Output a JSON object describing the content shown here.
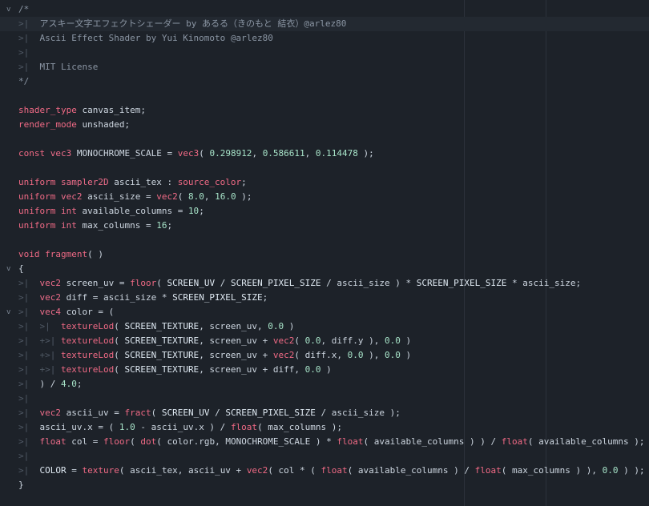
{
  "editor": {
    "lines": [
      {
        "fold": "v",
        "tokens": [
          {
            "t": "c",
            "v": "/*"
          }
        ]
      },
      {
        "fold": "",
        "tokens": [
          {
            "t": "tab",
            "v": ">|  "
          },
          {
            "t": "c",
            "v": "アスキー文字エフェクトシェーダー by あるる（きのもと 結衣）@arlez80"
          }
        ]
      },
      {
        "fold": "",
        "tokens": [
          {
            "t": "tab",
            "v": ">|  "
          },
          {
            "t": "c",
            "v": "Ascii Effect Shader by Yui Kinomoto @arlez80"
          }
        ]
      },
      {
        "fold": "",
        "tokens": [
          {
            "t": "tab",
            "v": ">|"
          }
        ]
      },
      {
        "fold": "",
        "tokens": [
          {
            "t": "tab",
            "v": ">|  "
          },
          {
            "t": "c",
            "v": "MIT License"
          }
        ]
      },
      {
        "fold": "",
        "tokens": [
          {
            "t": "c",
            "v": "*/"
          }
        ]
      },
      {
        "fold": "",
        "tokens": []
      },
      {
        "fold": "",
        "tokens": [
          {
            "t": "k",
            "v": "shader_type"
          },
          {
            "t": "p",
            "v": " canvas_item;"
          }
        ]
      },
      {
        "fold": "",
        "tokens": [
          {
            "t": "k",
            "v": "render_mode"
          },
          {
            "t": "p",
            "v": " unshaded;"
          }
        ]
      },
      {
        "fold": "",
        "tokens": []
      },
      {
        "fold": "",
        "tokens": [
          {
            "t": "k",
            "v": "const"
          },
          {
            "t": "p",
            "v": " "
          },
          {
            "t": "t",
            "v": "vec3"
          },
          {
            "t": "p",
            "v": " MONOCHROME_SCALE = "
          },
          {
            "t": "f",
            "v": "vec3"
          },
          {
            "t": "p",
            "v": "( "
          },
          {
            "t": "n",
            "v": "0.298912"
          },
          {
            "t": "p",
            "v": ", "
          },
          {
            "t": "n",
            "v": "0.586611"
          },
          {
            "t": "p",
            "v": ", "
          },
          {
            "t": "n",
            "v": "0.114478"
          },
          {
            "t": "p",
            "v": " );"
          }
        ]
      },
      {
        "fold": "",
        "tokens": []
      },
      {
        "fold": "",
        "tokens": [
          {
            "t": "k",
            "v": "uniform"
          },
          {
            "t": "p",
            "v": " "
          },
          {
            "t": "t",
            "v": "sampler2D"
          },
          {
            "t": "p",
            "v": " ascii_tex : "
          },
          {
            "t": "k",
            "v": "source_color"
          },
          {
            "t": "p",
            "v": ";"
          }
        ]
      },
      {
        "fold": "",
        "tokens": [
          {
            "t": "k",
            "v": "uniform"
          },
          {
            "t": "p",
            "v": " "
          },
          {
            "t": "t",
            "v": "vec2"
          },
          {
            "t": "p",
            "v": " ascii_size = "
          },
          {
            "t": "f",
            "v": "vec2"
          },
          {
            "t": "p",
            "v": "( "
          },
          {
            "t": "n",
            "v": "8.0"
          },
          {
            "t": "p",
            "v": ", "
          },
          {
            "t": "n",
            "v": "16.0"
          },
          {
            "t": "p",
            "v": " );"
          }
        ]
      },
      {
        "fold": "",
        "tokens": [
          {
            "t": "k",
            "v": "uniform"
          },
          {
            "t": "p",
            "v": " "
          },
          {
            "t": "t",
            "v": "int"
          },
          {
            "t": "p",
            "v": " available_columns = "
          },
          {
            "t": "n",
            "v": "10"
          },
          {
            "t": "p",
            "v": ";"
          }
        ]
      },
      {
        "fold": "",
        "tokens": [
          {
            "t": "k",
            "v": "uniform"
          },
          {
            "t": "p",
            "v": " "
          },
          {
            "t": "t",
            "v": "int"
          },
          {
            "t": "p",
            "v": " max_columns = "
          },
          {
            "t": "n",
            "v": "16"
          },
          {
            "t": "p",
            "v": ";"
          }
        ]
      },
      {
        "fold": "",
        "tokens": []
      },
      {
        "fold": "",
        "tokens": [
          {
            "t": "k",
            "v": "void"
          },
          {
            "t": "p",
            "v": " "
          },
          {
            "t": "f",
            "v": "fragment"
          },
          {
            "t": "p",
            "v": "( )"
          }
        ]
      },
      {
        "fold": "v",
        "tokens": [
          {
            "t": "p",
            "v": "{"
          }
        ]
      },
      {
        "fold": "",
        "tokens": [
          {
            "t": "tab",
            "v": ">|  "
          },
          {
            "t": "t",
            "v": "vec2"
          },
          {
            "t": "p",
            "v": " screen_uv = "
          },
          {
            "t": "f",
            "v": "floor"
          },
          {
            "t": "p",
            "v": "( "
          },
          {
            "t": "cst",
            "v": "SCREEN_UV"
          },
          {
            "t": "p",
            "v": " / "
          },
          {
            "t": "cst",
            "v": "SCREEN_PIXEL_SIZE"
          },
          {
            "t": "p",
            "v": " / ascii_size ) * "
          },
          {
            "t": "cst",
            "v": "SCREEN_PIXEL_SIZE"
          },
          {
            "t": "p",
            "v": " * ascii_size;"
          }
        ]
      },
      {
        "fold": "",
        "tokens": [
          {
            "t": "tab",
            "v": ">|  "
          },
          {
            "t": "t",
            "v": "vec2"
          },
          {
            "t": "p",
            "v": " diff = ascii_size * "
          },
          {
            "t": "cst",
            "v": "SCREEN_PIXEL_SIZE"
          },
          {
            "t": "p",
            "v": ";"
          }
        ]
      },
      {
        "fold": "v",
        "tokens": [
          {
            "t": "tab",
            "v": ">|  "
          },
          {
            "t": "t",
            "v": "vec4"
          },
          {
            "t": "p",
            "v": " color = ("
          }
        ]
      },
      {
        "fold": "",
        "tokens": [
          {
            "t": "tab",
            "v": ">|  >|  "
          },
          {
            "t": "f",
            "v": "textureLod"
          },
          {
            "t": "p",
            "v": "( "
          },
          {
            "t": "cst",
            "v": "SCREEN_TEXTURE"
          },
          {
            "t": "p",
            "v": ", screen_uv, "
          },
          {
            "t": "n",
            "v": "0.0"
          },
          {
            "t": "p",
            "v": " )"
          }
        ]
      },
      {
        "fold": "",
        "tokens": [
          {
            "t": "tab",
            "v": ">|  +>| "
          },
          {
            "t": "f",
            "v": "textureLod"
          },
          {
            "t": "p",
            "v": "( "
          },
          {
            "t": "cst",
            "v": "SCREEN_TEXTURE"
          },
          {
            "t": "p",
            "v": ", screen_uv + "
          },
          {
            "t": "f",
            "v": "vec2"
          },
          {
            "t": "p",
            "v": "( "
          },
          {
            "t": "n",
            "v": "0.0"
          },
          {
            "t": "p",
            "v": ", diff.y ), "
          },
          {
            "t": "n",
            "v": "0.0"
          },
          {
            "t": "p",
            "v": " )"
          }
        ]
      },
      {
        "fold": "",
        "tokens": [
          {
            "t": "tab",
            "v": ">|  +>| "
          },
          {
            "t": "f",
            "v": "textureLod"
          },
          {
            "t": "p",
            "v": "( "
          },
          {
            "t": "cst",
            "v": "SCREEN_TEXTURE"
          },
          {
            "t": "p",
            "v": ", screen_uv + "
          },
          {
            "t": "f",
            "v": "vec2"
          },
          {
            "t": "p",
            "v": "( diff.x, "
          },
          {
            "t": "n",
            "v": "0.0"
          },
          {
            "t": "p",
            "v": " ), "
          },
          {
            "t": "n",
            "v": "0.0"
          },
          {
            "t": "p",
            "v": " )"
          }
        ]
      },
      {
        "fold": "",
        "tokens": [
          {
            "t": "tab",
            "v": ">|  +>| "
          },
          {
            "t": "f",
            "v": "textureLod"
          },
          {
            "t": "p",
            "v": "( "
          },
          {
            "t": "cst",
            "v": "SCREEN_TEXTURE"
          },
          {
            "t": "p",
            "v": ", screen_uv + diff, "
          },
          {
            "t": "n",
            "v": "0.0"
          },
          {
            "t": "p",
            "v": " )"
          }
        ]
      },
      {
        "fold": "",
        "tokens": [
          {
            "t": "tab",
            "v": ">|  "
          },
          {
            "t": "p",
            "v": ") / "
          },
          {
            "t": "n",
            "v": "4.0"
          },
          {
            "t": "p",
            "v": ";"
          }
        ]
      },
      {
        "fold": "",
        "tokens": [
          {
            "t": "tab",
            "v": ">|"
          }
        ]
      },
      {
        "fold": "",
        "tokens": [
          {
            "t": "tab",
            "v": ">|  "
          },
          {
            "t": "t",
            "v": "vec2"
          },
          {
            "t": "p",
            "v": " ascii_uv = "
          },
          {
            "t": "f",
            "v": "fract"
          },
          {
            "t": "p",
            "v": "( "
          },
          {
            "t": "cst",
            "v": "SCREEN_UV"
          },
          {
            "t": "p",
            "v": " / "
          },
          {
            "t": "cst",
            "v": "SCREEN_PIXEL_SIZE"
          },
          {
            "t": "p",
            "v": " / ascii_size );"
          }
        ]
      },
      {
        "fold": "",
        "tokens": [
          {
            "t": "tab",
            "v": ">|  "
          },
          {
            "t": "p",
            "v": "ascii_uv.x = ( "
          },
          {
            "t": "n",
            "v": "1.0"
          },
          {
            "t": "p",
            "v": " - ascii_uv.x ) / "
          },
          {
            "t": "f",
            "v": "float"
          },
          {
            "t": "p",
            "v": "( max_columns );"
          }
        ]
      },
      {
        "fold": "",
        "tokens": [
          {
            "t": "tab",
            "v": ">|  "
          },
          {
            "t": "t",
            "v": "float"
          },
          {
            "t": "p",
            "v": " col = "
          },
          {
            "t": "f",
            "v": "floor"
          },
          {
            "t": "p",
            "v": "( "
          },
          {
            "t": "f",
            "v": "dot"
          },
          {
            "t": "p",
            "v": "( color.rgb, MONOCHROME_SCALE ) * "
          },
          {
            "t": "f",
            "v": "float"
          },
          {
            "t": "p",
            "v": "( available_columns ) ) / "
          },
          {
            "t": "f",
            "v": "float"
          },
          {
            "t": "p",
            "v": "( available_columns );"
          }
        ]
      },
      {
        "fold": "",
        "tokens": [
          {
            "t": "tab",
            "v": ">|"
          }
        ]
      },
      {
        "fold": "",
        "tokens": [
          {
            "t": "tab",
            "v": ">|  "
          },
          {
            "t": "cst",
            "v": "COLOR"
          },
          {
            "t": "p",
            "v": " = "
          },
          {
            "t": "f",
            "v": "texture"
          },
          {
            "t": "p",
            "v": "( ascii_tex, ascii_uv + "
          },
          {
            "t": "f",
            "v": "vec2"
          },
          {
            "t": "p",
            "v": "( col * ( "
          },
          {
            "t": "f",
            "v": "float"
          },
          {
            "t": "p",
            "v": "( available_columns ) / "
          },
          {
            "t": "f",
            "v": "float"
          },
          {
            "t": "p",
            "v": "( max_columns ) ), "
          },
          {
            "t": "n",
            "v": "0.0"
          },
          {
            "t": "p",
            "v": " ) );"
          }
        ]
      },
      {
        "fold": "",
        "tokens": [
          {
            "t": "p",
            "v": "}"
          }
        ]
      }
    ]
  }
}
